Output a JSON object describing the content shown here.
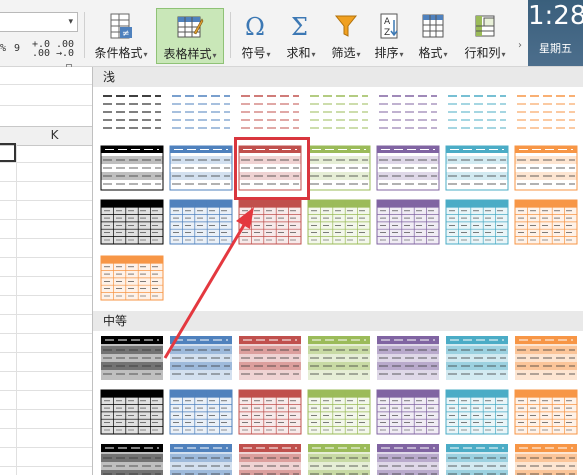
{
  "ribbon": {
    "number_formats": [
      {
        "symbol": "%"
      },
      {
        "symbol": "9"
      },
      {
        "symbol": "+.0\n.00"
      },
      {
        "symbol": ".00\n→.0"
      }
    ],
    "buttons": [
      {
        "label": "条件格式",
        "icon": "conditional-format-icon",
        "dropdown": true
      },
      {
        "label": "表格样式",
        "icon": "table-style-icon",
        "dropdown": true,
        "active": true
      },
      {
        "label": "符号",
        "icon": "omega-icon",
        "dropdown": true
      },
      {
        "label": "求和",
        "icon": "sigma-icon",
        "dropdown": true
      },
      {
        "label": "筛选",
        "icon": "filter-icon",
        "dropdown": true
      },
      {
        "label": "排序",
        "icon": "sort-az-icon",
        "dropdown": true
      },
      {
        "label": "格式",
        "icon": "format-icon",
        "dropdown": true
      },
      {
        "label": "行和列",
        "icon": "row-col-icon",
        "dropdown": true
      }
    ],
    "dropdown_glyph": "▾",
    "more_glyph": "›",
    "combo_arrow": "▾"
  },
  "clock": {
    "time": "1:28",
    "day": "星期五"
  },
  "sheet": {
    "column_header": "K"
  },
  "style_panel": {
    "sections": [
      {
        "title": "浅"
      },
      {
        "title": "中等"
      }
    ]
  },
  "colors": {
    "accent_active": "#c9e7b8",
    "annotation_red": "#d9363e",
    "style_colors": [
      "#000000",
      "#4f81bd",
      "#c0504d",
      "#9bbb59",
      "#8064a2",
      "#4bacc6",
      "#f79646"
    ]
  }
}
